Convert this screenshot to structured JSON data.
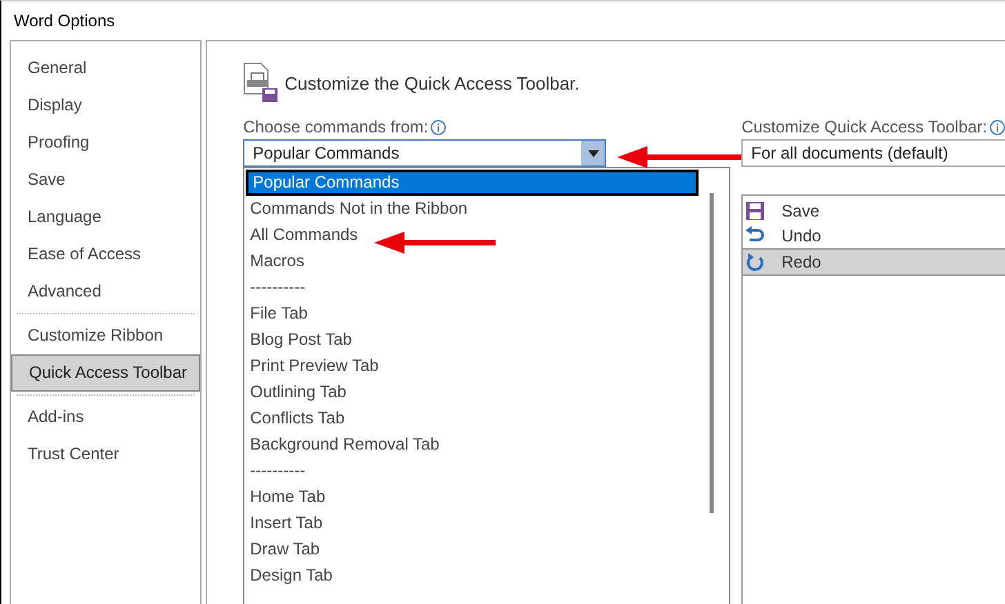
{
  "window": {
    "title": "Word Options"
  },
  "sidebar": {
    "groups": [
      [
        {
          "label": "General",
          "selected": false
        },
        {
          "label": "Display",
          "selected": false
        },
        {
          "label": "Proofing",
          "selected": false
        },
        {
          "label": "Save",
          "selected": false
        },
        {
          "label": "Language",
          "selected": false
        },
        {
          "label": "Ease of Access",
          "selected": false
        },
        {
          "label": "Advanced",
          "selected": false
        }
      ],
      [
        {
          "label": "Customize Ribbon",
          "selected": false
        },
        {
          "label": "Quick Access Toolbar",
          "selected": true
        }
      ],
      [
        {
          "label": "Add-ins",
          "selected": false
        },
        {
          "label": "Trust Center",
          "selected": false
        }
      ]
    ]
  },
  "header": {
    "title": "Customize the Quick Access Toolbar."
  },
  "choose_commands": {
    "label": "Choose commands from:",
    "value": "Popular Commands",
    "options": [
      {
        "label": "Popular Commands",
        "selected": true
      },
      {
        "label": "Commands Not in the Ribbon",
        "selected": false
      },
      {
        "label": "All Commands",
        "selected": false
      },
      {
        "label": "Macros",
        "selected": false
      },
      {
        "label": "----------",
        "selected": false
      },
      {
        "label": "File Tab",
        "selected": false
      },
      {
        "label": "Blog Post Tab",
        "selected": false
      },
      {
        "label": "Print Preview Tab",
        "selected": false
      },
      {
        "label": "Outlining Tab",
        "selected": false
      },
      {
        "label": "Conflicts Tab",
        "selected": false
      },
      {
        "label": "Background Removal Tab",
        "selected": false
      },
      {
        "label": "----------",
        "selected": false
      },
      {
        "label": "Home Tab",
        "selected": false
      },
      {
        "label": "Insert Tab",
        "selected": false
      },
      {
        "label": "Draw Tab",
        "selected": false
      },
      {
        "label": "Design Tab",
        "selected": false
      }
    ]
  },
  "customize_toolbar": {
    "label": "Customize Quick Access Toolbar:",
    "value": "For all documents (default)",
    "commands": [
      {
        "label": "Save",
        "kind": "save",
        "selected": false
      },
      {
        "label": "Undo",
        "kind": "undo",
        "selected": false
      },
      {
        "label": "Redo",
        "kind": "redo",
        "selected": true
      }
    ]
  }
}
